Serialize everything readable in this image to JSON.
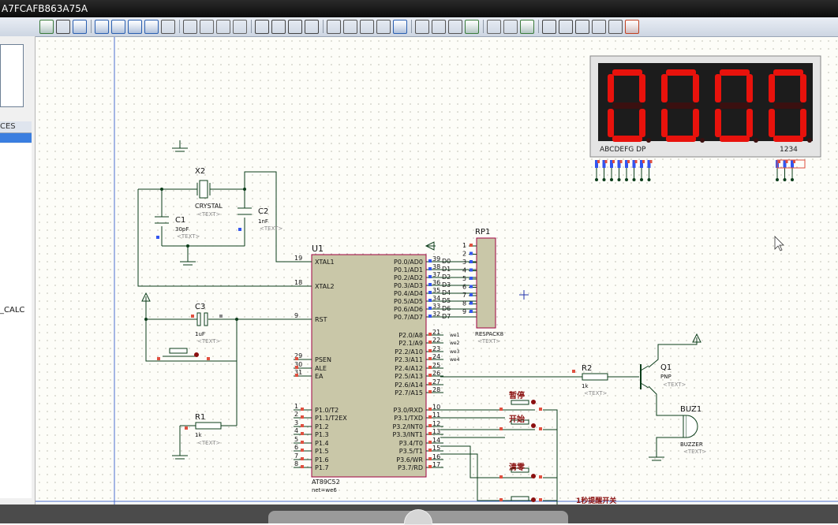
{
  "window": {
    "title": "A7FCAFB863A75A"
  },
  "sidebar": {
    "devices_header": "CES",
    "device_item": "_CALC"
  },
  "display": {
    "digits": [
      "0",
      "0",
      "0",
      "0"
    ],
    "seg_label": "ABCDEFG  DP",
    "digit_label": "1234"
  },
  "components": {
    "u1_ref": "U1",
    "u1_part": "AT89C52",
    "u1_net": "net=we6",
    "x2_ref": "X2",
    "x2_val": "CRYSTAL",
    "c1_ref": "C1",
    "c1_val": "30pF",
    "c2_ref": "C2",
    "c2_val": "1nF",
    "c3_ref": "C3",
    "c3_val": "1uF",
    "r1_ref": "R1",
    "r1_val": "1k",
    "r2_ref": "R2",
    "r2_val": "1k",
    "rp1_ref": "RP1",
    "rp1_val": "RESPACK8",
    "q1_ref": "Q1",
    "q1_val": "PNP",
    "buz1_ref": "BUZ1",
    "buz1_val": "BUZZER",
    "text_tag": "<TEXT>"
  },
  "pins_left": [
    {
      "num": "19",
      "name": "XTAL1"
    },
    {
      "num": "18",
      "name": "XTAL2"
    },
    {
      "num": "9",
      "name": "RST"
    },
    {
      "num": "29",
      "name": "PSEN"
    },
    {
      "num": "30",
      "name": "ALE"
    },
    {
      "num": "31",
      "name": "EA"
    },
    {
      "num": "1",
      "name": "P1.0/T2"
    },
    {
      "num": "2",
      "name": "P1.1/T2EX"
    },
    {
      "num": "3",
      "name": "P1.2"
    },
    {
      "num": "4",
      "name": "P1.3"
    },
    {
      "num": "5",
      "name": "P1.4"
    },
    {
      "num": "6",
      "name": "P1.5"
    },
    {
      "num": "7",
      "name": "P1.6"
    },
    {
      "num": "8",
      "name": "P1.7"
    }
  ],
  "pins_right": [
    {
      "num": "39",
      "name": "P0.0/AD0",
      "net": "D0"
    },
    {
      "num": "38",
      "name": "P0.1/AD1",
      "net": "D1"
    },
    {
      "num": "37",
      "name": "P0.2/AD2",
      "net": "D2"
    },
    {
      "num": "36",
      "name": "P0.3/AD3",
      "net": "D3"
    },
    {
      "num": "35",
      "name": "P0.4/AD4",
      "net": "D4"
    },
    {
      "num": "34",
      "name": "P0.5/AD5",
      "net": "D5"
    },
    {
      "num": "33",
      "name": "P0.6/AD6",
      "net": "D6"
    },
    {
      "num": "32",
      "name": "P0.7/AD7",
      "net": "D7"
    },
    {
      "num": "21",
      "name": "P2.0/A8",
      "net": "we1"
    },
    {
      "num": "22",
      "name": "P2.1/A9",
      "net": "we2"
    },
    {
      "num": "23",
      "name": "P2.2/A10",
      "net": "we3"
    },
    {
      "num": "24",
      "name": "P2.3/A11",
      "net": "we4"
    },
    {
      "num": "25",
      "name": "P2.4/A12",
      "net": ""
    },
    {
      "num": "26",
      "name": "P2.5/A13",
      "net": ""
    },
    {
      "num": "27",
      "name": "P2.6/A14",
      "net": ""
    },
    {
      "num": "28",
      "name": "P2.7/A15",
      "net": ""
    },
    {
      "num": "10",
      "name": "P3.0/RXD",
      "net": ""
    },
    {
      "num": "11",
      "name": "P3.1/TXD",
      "net": ""
    },
    {
      "num": "12",
      "name": "P3.2/INT0",
      "net": ""
    },
    {
      "num": "13",
      "name": "P3.3/INT1",
      "net": ""
    },
    {
      "num": "14",
      "name": "P3.4/T0",
      "net": ""
    },
    {
      "num": "15",
      "name": "P3.5/T1",
      "net": ""
    },
    {
      "num": "16",
      "name": "P3.6/WR",
      "net": ""
    },
    {
      "num": "17",
      "name": "P3.7/RD",
      "net": ""
    }
  ],
  "rp1_pins": [
    "1",
    "2",
    "3",
    "4",
    "5",
    "6",
    "7",
    "8",
    "9"
  ],
  "buttons": {
    "pause": "暂停",
    "start": "开始",
    "clear": "清零",
    "alarm": "1秒提醒开关"
  },
  "colors": {
    "chip_fill": "#c9c7a8",
    "chip_border": "#a00040",
    "wire": "#0b3d1a",
    "segment_on": "#e8120c",
    "display_bg": "#1a1a1a"
  }
}
